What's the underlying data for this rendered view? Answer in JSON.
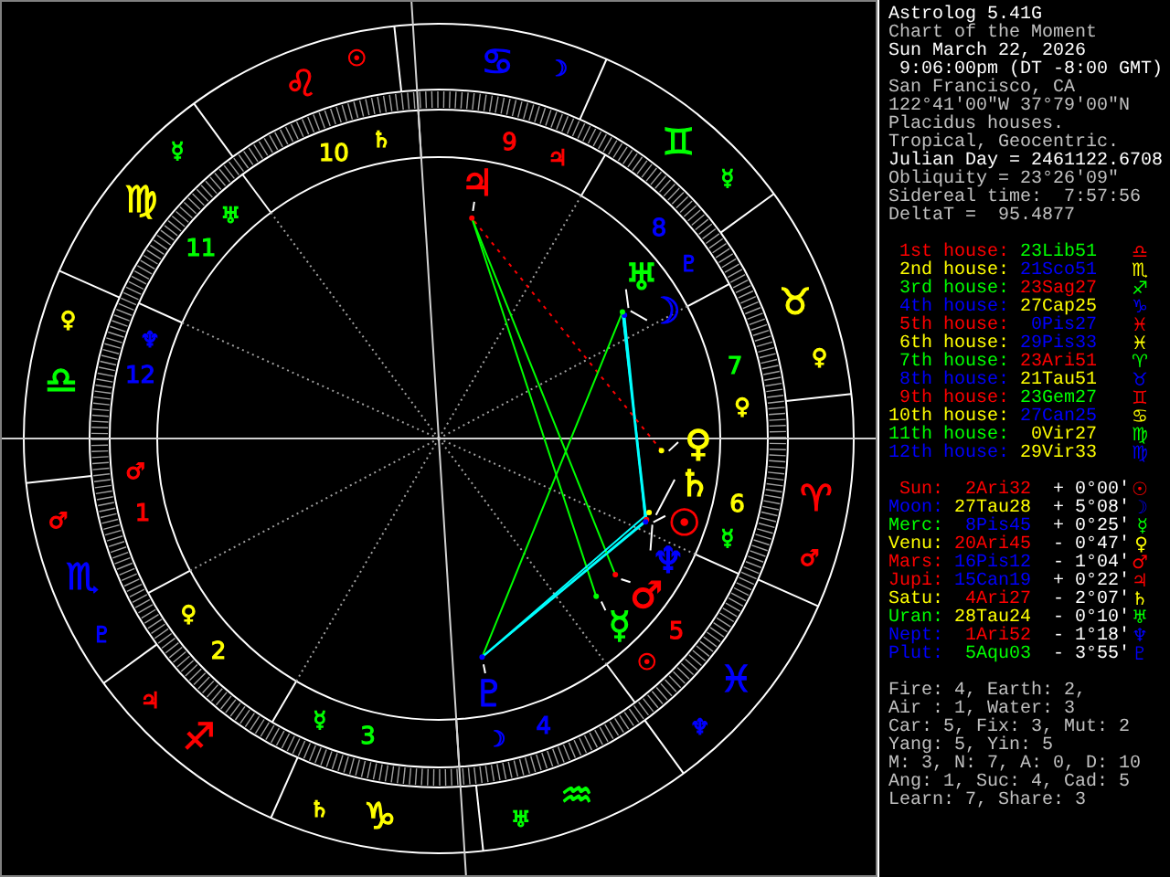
{
  "info": {
    "lines": [
      {
        "text": "Astrolog 5.41G",
        "color": "#ffffff"
      },
      {
        "text": "Chart of the Moment",
        "color": "#c0c0c0"
      },
      {
        "text": "Sun March 22, 2026",
        "color": "#ffffff"
      },
      {
        "text": " 9:06:00pm (DT -8:00 GMT)",
        "color": "#ffffff"
      },
      {
        "text": "San Francisco, CA",
        "color": "#c0c0c0"
      },
      {
        "text": "122°41'00\"W 37°79'00\"N",
        "color": "#c0c0c0"
      },
      {
        "text": "Placidus houses.",
        "color": "#c0c0c0"
      },
      {
        "text": "Tropical, Geocentric.",
        "color": "#c0c0c0"
      },
      {
        "text": "Julian Day = 2461122.6708",
        "color": "#ffffff"
      },
      {
        "text": "Obliquity = 23°26'09\"",
        "color": "#c0c0c0"
      },
      {
        "text": "Sidereal time:  7:57:56",
        "color": "#c0c0c0"
      },
      {
        "text": "DeltaT =  95.4877",
        "color": "#c0c0c0"
      }
    ]
  },
  "house_table": [
    {
      "label": "1st house:",
      "color": "#ff0000",
      "cusp": {
        "text": "23Lib51",
        "color": "#00ff00"
      },
      "sign": "♎"
    },
    {
      "label": "2nd house:",
      "color": "#ffff00",
      "cusp": {
        "text": "21Sco51",
        "color": "#0000ff"
      },
      "sign": "♏"
    },
    {
      "label": "3rd house:",
      "color": "#00ff00",
      "cusp": {
        "text": "23Sag27",
        "color": "#ff0000"
      },
      "sign": "♐"
    },
    {
      "label": "4th house:",
      "color": "#0000ff",
      "cusp": {
        "text": "27Cap25",
        "color": "#ffff00"
      },
      "sign": "♑"
    },
    {
      "label": "5th house:",
      "color": "#ff0000",
      "cusp": {
        "text": "0Pis27",
        "color": "#0000ff"
      },
      "sign": "♓"
    },
    {
      "label": "6th house:",
      "color": "#ffff00",
      "cusp": {
        "text": "29Pis33",
        "color": "#0000ff"
      },
      "sign": "♓"
    },
    {
      "label": "7th house:",
      "color": "#00ff00",
      "cusp": {
        "text": "23Ari51",
        "color": "#ff0000"
      },
      "sign": "♈"
    },
    {
      "label": "8th house:",
      "color": "#0000ff",
      "cusp": {
        "text": "21Tau51",
        "color": "#ffff00"
      },
      "sign": "♉"
    },
    {
      "label": "9th house:",
      "color": "#ff0000",
      "cusp": {
        "text": "23Gem27",
        "color": "#00ff00"
      },
      "sign": "♊"
    },
    {
      "label": "10th house:",
      "color": "#ffff00",
      "cusp": {
        "text": "27Can25",
        "color": "#0000ff"
      },
      "sign": "♋"
    },
    {
      "label": "11th house:",
      "color": "#00ff00",
      "cusp": {
        "text": "0Vir27",
        "color": "#ffff00"
      },
      "sign": "♍"
    },
    {
      "label": "12th house:",
      "color": "#0000ff",
      "cusp": {
        "text": "29Vir33",
        "color": "#ffff00"
      },
      "sign": "♍"
    }
  ],
  "planet_table": [
    {
      "name": "Sun:",
      "color": "#ff0000",
      "position": {
        "text": "2Ari32",
        "color": "#ff0000"
      },
      "motion": "+ 0°00'",
      "glyph": "☉"
    },
    {
      "name": "Moon:",
      "color": "#0000ff",
      "position": {
        "text": "27Tau28",
        "color": "#ffff00"
      },
      "motion": "+ 5°08'",
      "glyph": "☽"
    },
    {
      "name": "Merc:",
      "color": "#00ff00",
      "position": {
        "text": "8Pis45",
        "color": "#0000ff"
      },
      "motion": "+ 0°25'",
      "glyph": "☿"
    },
    {
      "name": "Venu:",
      "color": "#ffff00",
      "position": {
        "text": "20Ari45",
        "color": "#ff0000"
      },
      "motion": "- 0°47'",
      "glyph": "♀"
    },
    {
      "name": "Mars:",
      "color": "#ff0000",
      "position": {
        "text": "16Pis12",
        "color": "#0000ff"
      },
      "motion": "- 1°04'",
      "glyph": "♂"
    },
    {
      "name": "Jupi:",
      "color": "#ff0000",
      "position": {
        "text": "15Can19",
        "color": "#0000ff"
      },
      "motion": "+ 0°22'",
      "glyph": "♃"
    },
    {
      "name": "Satu:",
      "color": "#ffff00",
      "position": {
        "text": "4Ari27",
        "color": "#ff0000"
      },
      "motion": "- 2°07'",
      "glyph": "♄"
    },
    {
      "name": "Uran:",
      "color": "#00ff00",
      "position": {
        "text": "28Tau24",
        "color": "#ffff00"
      },
      "motion": "- 0°10'",
      "glyph": "♅"
    },
    {
      "name": "Nept:",
      "color": "#0000ff",
      "position": {
        "text": "1Ari52",
        "color": "#ff0000"
      },
      "motion": "- 1°18'",
      "glyph": "♆"
    },
    {
      "name": "Plut:",
      "color": "#0000ff",
      "position": {
        "text": "5Aqu03",
        "color": "#00ff00"
      },
      "motion": "- 3°55'",
      "glyph": "♇"
    }
  ],
  "summary": [
    "Fire: 4, Earth: 2,",
    "Air : 1, Water: 3",
    "Car: 5, Fix: 3, Mut: 2",
    "Yang: 5, Yin: 5",
    "M: 3, N: 7, A: 0, D: 10",
    "Ang: 1, Suc: 4, Cad: 5",
    "Learn: 7, Share: 3"
  ],
  "wheel": {
    "signs": [
      {
        "glyph": "♈",
        "color": "#ff0000",
        "rulers": [
          {
            "glyph": "♂",
            "color": "#ff0000"
          }
        ]
      },
      {
        "glyph": "♉",
        "color": "#ffff00",
        "rulers": [
          {
            "glyph": "♀",
            "color": "#ffff00"
          }
        ]
      },
      {
        "glyph": "♊",
        "color": "#00ff00",
        "rulers": [
          {
            "glyph": "☿",
            "color": "#00ff00"
          }
        ]
      },
      {
        "glyph": "♋",
        "color": "#0000ff",
        "rulers": [
          {
            "glyph": "☽",
            "color": "#0000ff"
          }
        ]
      },
      {
        "glyph": "♌",
        "color": "#ff0000",
        "rulers": [
          {
            "glyph": "☉",
            "color": "#ff0000"
          }
        ]
      },
      {
        "glyph": "♍",
        "color": "#ffff00",
        "rulers": [
          {
            "glyph": "☿",
            "color": "#00ff00"
          }
        ]
      },
      {
        "glyph": "♎",
        "color": "#00ff00",
        "rulers": [
          {
            "glyph": "♀",
            "color": "#ffff00"
          }
        ]
      },
      {
        "glyph": "♏",
        "color": "#0000ff",
        "rulers": [
          {
            "glyph": "♂",
            "color": "#ff0000"
          },
          {
            "glyph": "♇",
            "color": "#0000ff"
          }
        ]
      },
      {
        "glyph": "♐",
        "color": "#ff0000",
        "rulers": [
          {
            "glyph": "♃",
            "color": "#ff0000"
          }
        ]
      },
      {
        "glyph": "♑",
        "color": "#ffff00",
        "rulers": [
          {
            "glyph": "♄",
            "color": "#ffff00"
          }
        ]
      },
      {
        "glyph": "♒",
        "color": "#00ff00",
        "rulers": [
          {
            "glyph": "♅",
            "color": "#00ff00"
          }
        ]
      },
      {
        "glyph": "♓",
        "color": "#0000ff",
        "rulers": [
          {
            "glyph": "♆",
            "color": "#0000ff"
          }
        ]
      }
    ],
    "houses": [
      {
        "number": "1",
        "color": "#ff0000",
        "ruler": {
          "glyph": "♂",
          "color": "#ff0000"
        }
      },
      {
        "number": "2",
        "color": "#ffff00",
        "ruler": {
          "glyph": "♀",
          "color": "#ffff00"
        }
      },
      {
        "number": "3",
        "color": "#00ff00",
        "ruler": {
          "glyph": "☿",
          "color": "#00ff00"
        }
      },
      {
        "number": "4",
        "color": "#0000ff",
        "ruler": {
          "glyph": "☽",
          "color": "#0000ff"
        }
      },
      {
        "number": "5",
        "color": "#ff0000",
        "ruler": {
          "glyph": "☉",
          "color": "#ff0000"
        }
      },
      {
        "number": "6",
        "color": "#ffff00",
        "ruler": {
          "glyph": "☿",
          "color": "#00ff00"
        }
      },
      {
        "number": "7",
        "color": "#00ff00",
        "ruler": {
          "glyph": "♀",
          "color": "#ffff00"
        }
      },
      {
        "number": "8",
        "color": "#0000ff",
        "ruler": {
          "glyph": "♇",
          "color": "#0000ff"
        }
      },
      {
        "number": "9",
        "color": "#ff0000",
        "ruler": {
          "glyph": "♃",
          "color": "#ff0000"
        }
      },
      {
        "number": "10",
        "color": "#ffff00",
        "ruler": {
          "glyph": "♄",
          "color": "#ffff00"
        }
      },
      {
        "number": "11",
        "color": "#00ff00",
        "ruler": {
          "glyph": "♅",
          "color": "#00ff00"
        }
      },
      {
        "number": "12",
        "color": "#0000ff",
        "ruler": {
          "glyph": "♆",
          "color": "#0000ff"
        }
      }
    ],
    "planets": [
      {
        "glyph": "☉",
        "color": "#ff0000"
      },
      {
        "glyph": "☽",
        "color": "#0000ff"
      },
      {
        "glyph": "☿",
        "color": "#00ff00"
      },
      {
        "glyph": "♀",
        "color": "#ffff00"
      },
      {
        "glyph": "♂",
        "color": "#ff0000"
      },
      {
        "glyph": "♃",
        "color": "#ff0000"
      },
      {
        "glyph": "♄",
        "color": "#ffff00"
      },
      {
        "glyph": "♅",
        "color": "#00ff00"
      },
      {
        "glyph": "♆",
        "color": "#0000ff"
      },
      {
        "glyph": "♇",
        "color": "#0000ff"
      }
    ]
  }
}
